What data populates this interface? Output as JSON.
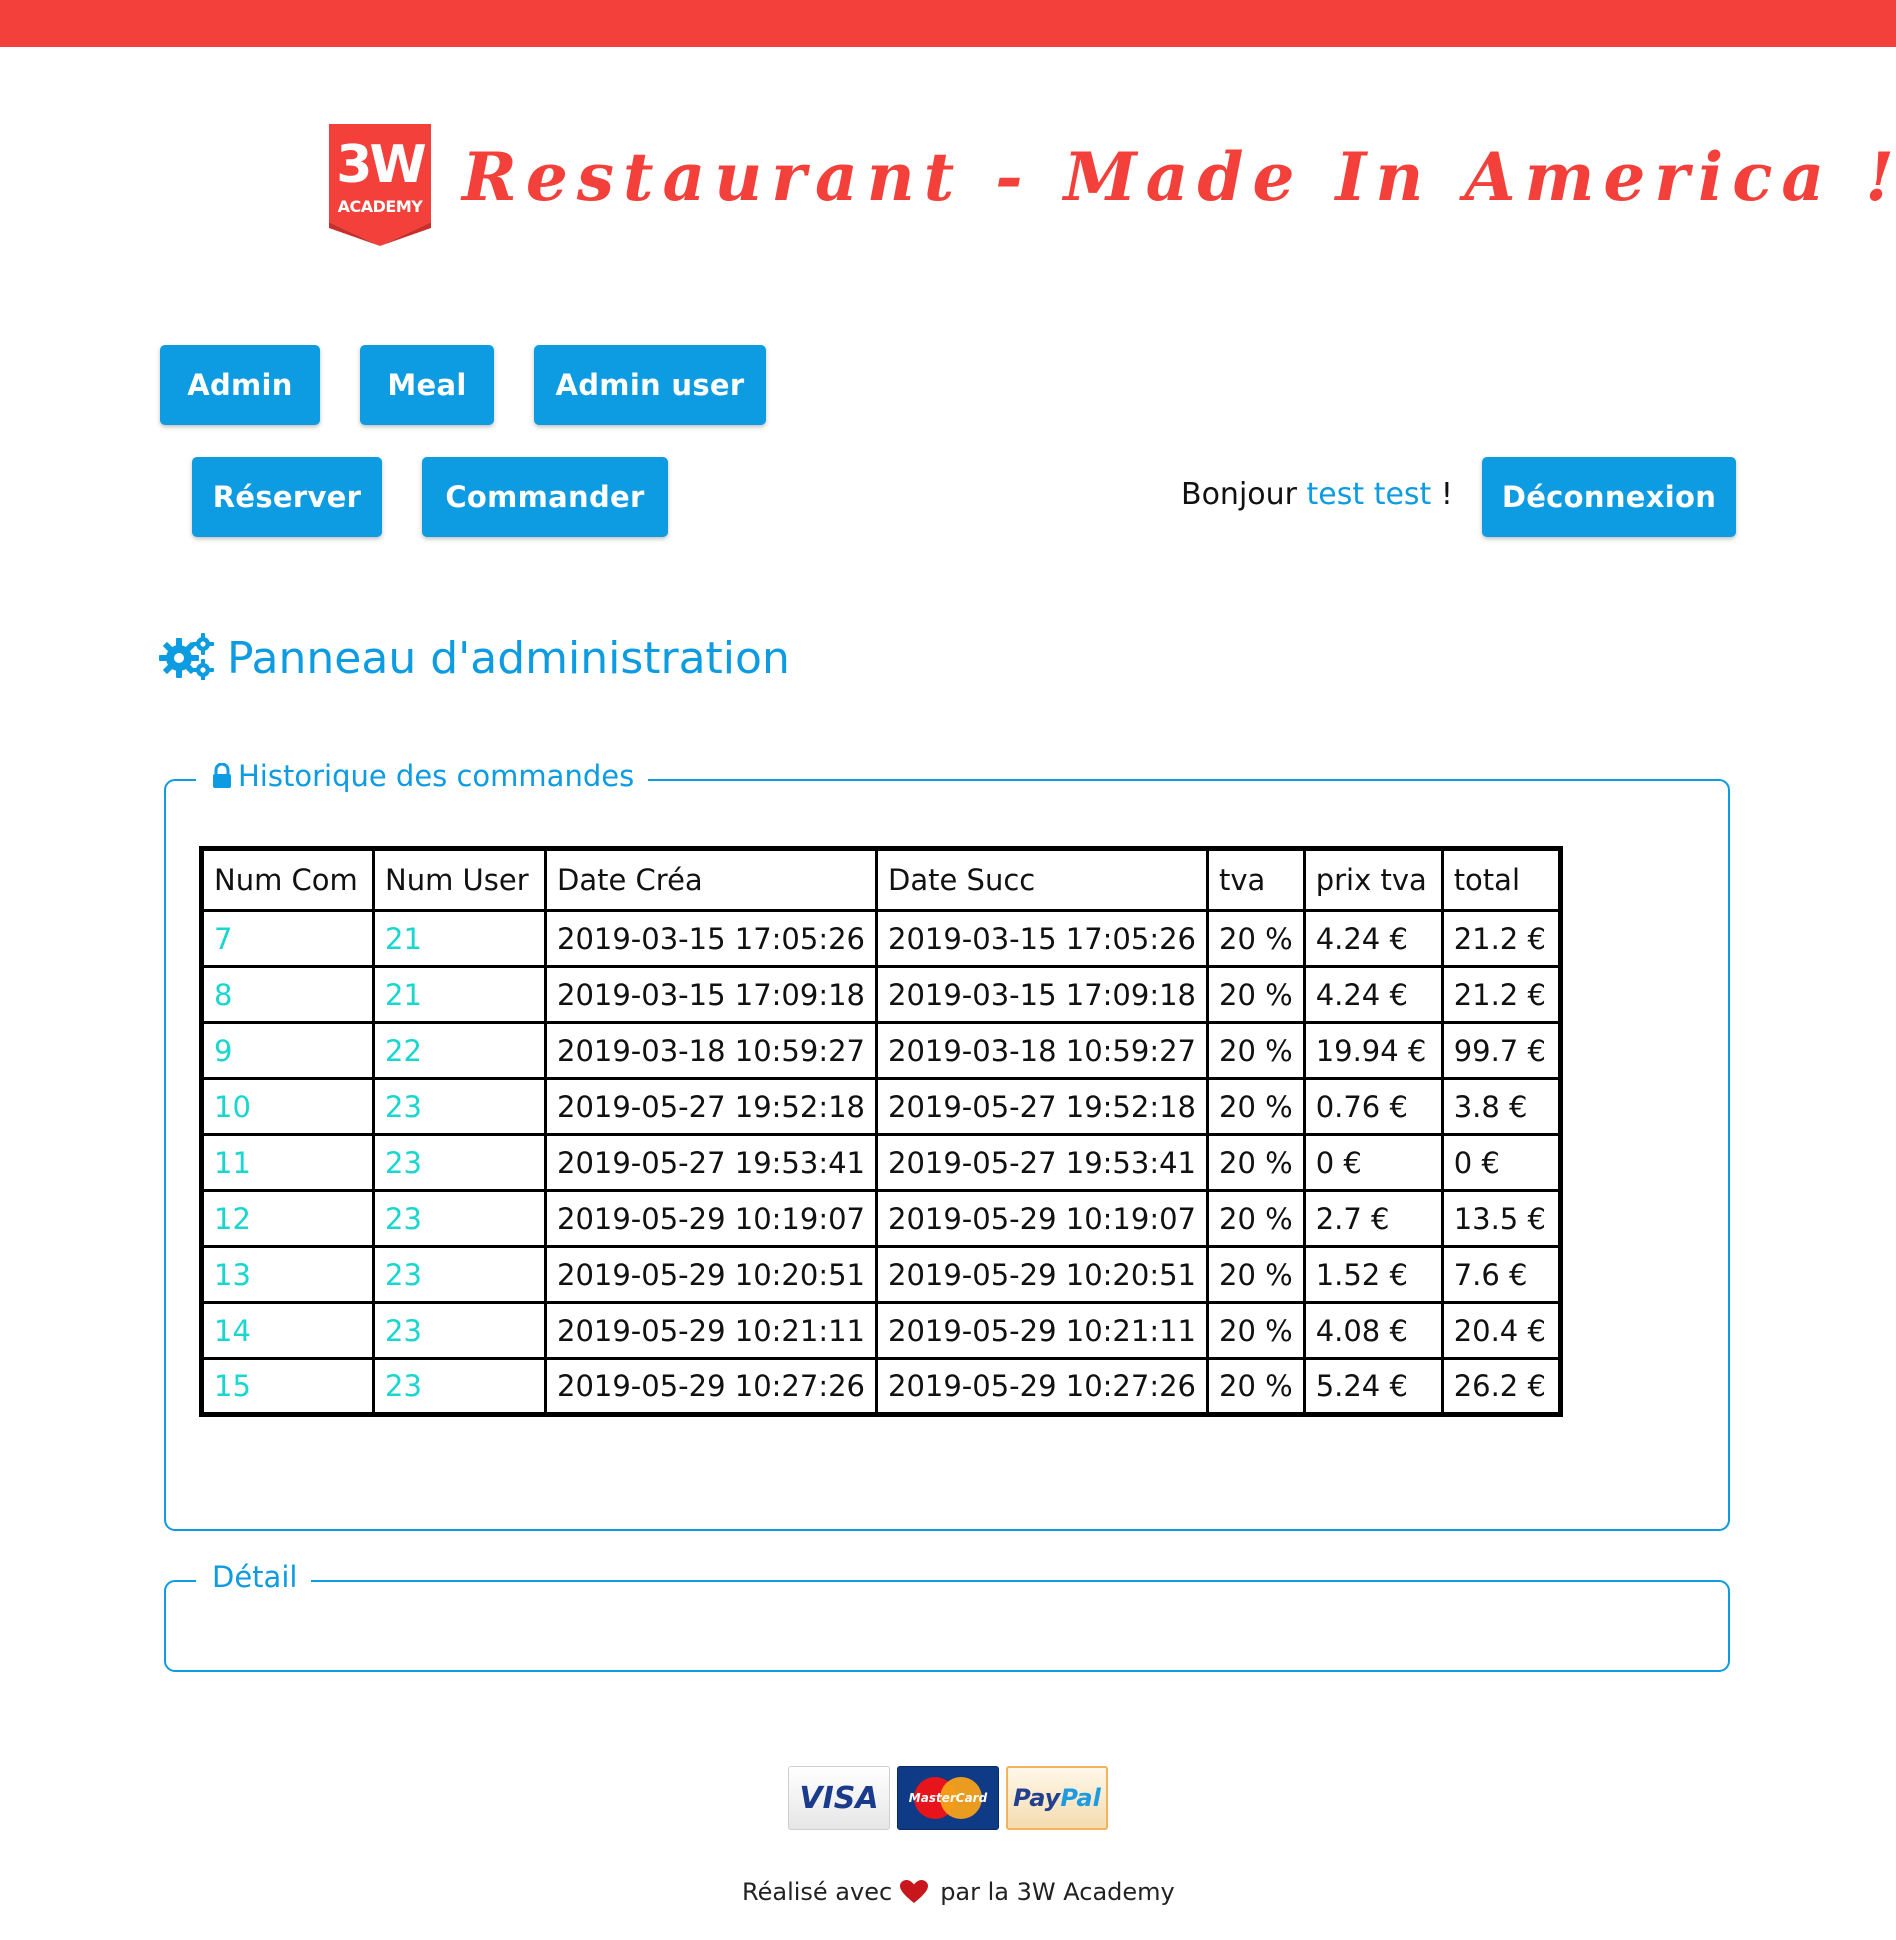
{
  "brand": {
    "logo_top": "3W",
    "logo_bottom": "ACADEMY",
    "title": "Restaurant - Made In America !"
  },
  "nav": {
    "admin": "Admin",
    "meal": "Meal",
    "admin_user": "Admin user",
    "reserver": "Réserver",
    "commander": "Commander",
    "deconnexion": "Déconnexion"
  },
  "greeting": {
    "hello": "Bonjour",
    "user": "test test",
    "exclaim": "!"
  },
  "admin": {
    "title": "Panneau d'administration",
    "icon": "gears-icon"
  },
  "history": {
    "legend": "Historique des commandes",
    "columns": [
      "Num Com",
      "Num User",
      "Date Créa",
      "Date Succ",
      "tva",
      "prix tva",
      "total"
    ],
    "rows": [
      [
        "7",
        "21",
        "2019-03-15 17:05:26",
        "2019-03-15 17:05:26",
        "20 %",
        "4.24 €",
        "21.2 €"
      ],
      [
        "8",
        "21",
        "2019-03-15 17:09:18",
        "2019-03-15 17:09:18",
        "20 %",
        "4.24 €",
        "21.2 €"
      ],
      [
        "9",
        "22",
        "2019-03-18 10:59:27",
        "2019-03-18 10:59:27",
        "20 %",
        "19.94 €",
        "99.7 €"
      ],
      [
        "10",
        "23",
        "2019-05-27 19:52:18",
        "2019-05-27 19:52:18",
        "20 %",
        "0.76 €",
        "3.8 €"
      ],
      [
        "11",
        "23",
        "2019-05-27 19:53:41",
        "2019-05-27 19:53:41",
        "20 %",
        "0 €",
        "0 €"
      ],
      [
        "12",
        "23",
        "2019-05-29 10:19:07",
        "2019-05-29 10:19:07",
        "20 %",
        "2.7 €",
        "13.5 €"
      ],
      [
        "13",
        "23",
        "2019-05-29 10:20:51",
        "2019-05-29 10:20:51",
        "20 %",
        "1.52 €",
        "7.6 €"
      ],
      [
        "14",
        "23",
        "2019-05-29 10:21:11",
        "2019-05-29 10:21:11",
        "20 %",
        "4.08 €",
        "20.4 €"
      ],
      [
        "15",
        "23",
        "2019-05-29 10:27:26",
        "2019-05-29 10:27:26",
        "20 %",
        "5.24 €",
        "26.2 €"
      ]
    ]
  },
  "detail": {
    "legend": "Détail"
  },
  "footer": {
    "payments": {
      "visa": "VISA",
      "mastercard": "MasterCard",
      "paypal_pay": "Pay",
      "paypal_pal": "Pal"
    },
    "made_with": "Réalisé avec",
    "by": "par la 3W Academy"
  },
  "colors": {
    "brand_red": "#f3403a",
    "primary_blue": "#0d9be2",
    "link_cyan": "#19d6cf"
  }
}
